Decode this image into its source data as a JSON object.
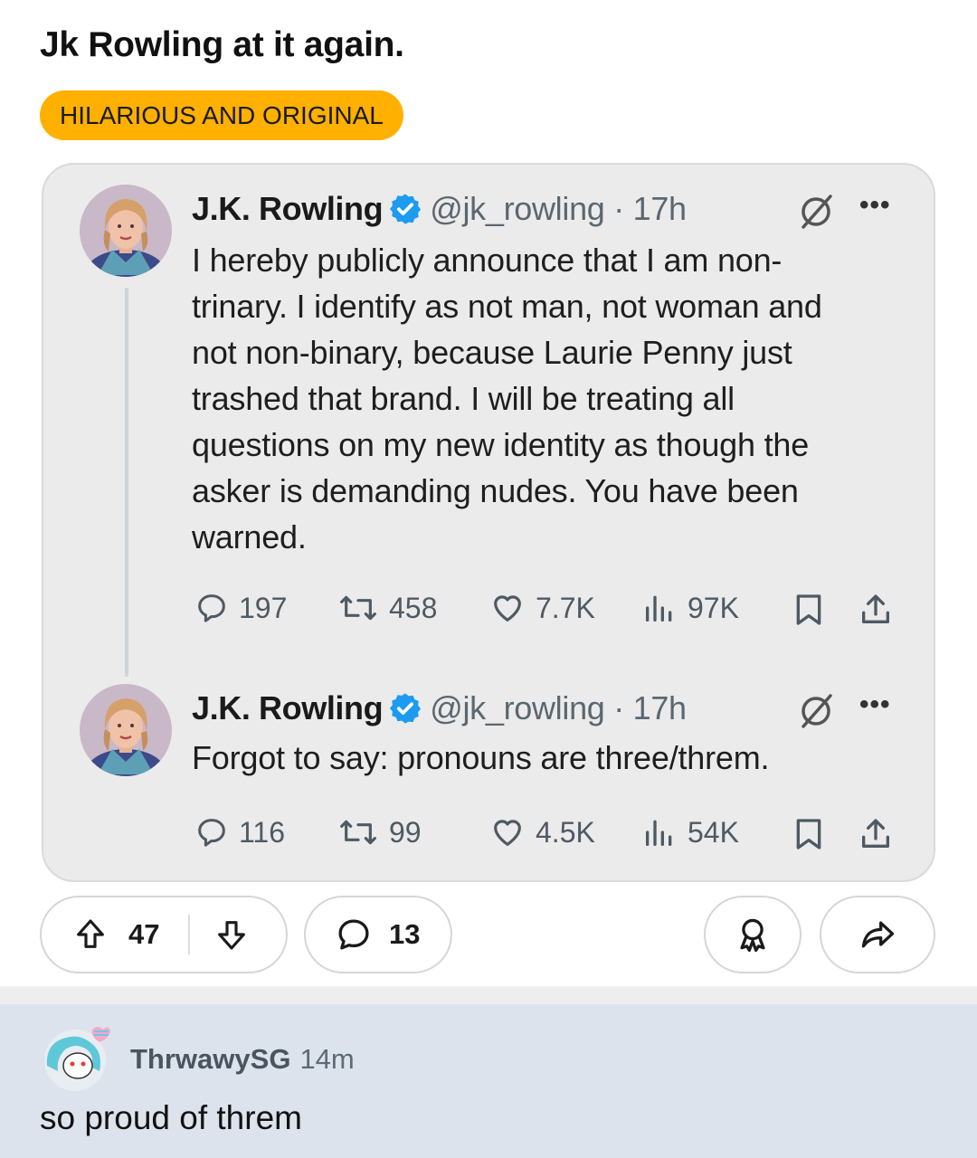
{
  "post": {
    "title": "Jk Rowling at it again.",
    "flair": "HILARIOUS AND ORIGINAL",
    "flair_color": "#ffb000"
  },
  "tweets": [
    {
      "name": "J.K. Rowling",
      "handle": "@jk_rowling · 17h",
      "text": "I hereby publicly announce that I am non-\ntrinary. I identify as not man, not woman and\nnot non-binary, because Laurie Penny just\ntrashed that brand. I will be treating all\nquestions on my new identity as though the\nasker is demanding nudes. You have been\nwarned.",
      "replies": "197",
      "retweets": "458",
      "likes": "7.7K",
      "views": "97K"
    },
    {
      "name": "J.K. Rowling",
      "handle": "@jk_rowling · 17h",
      "text": "Forgot to say: pronouns are three/threm.",
      "replies": "116",
      "retweets": "99",
      "likes": "4.5K",
      "views": "54K"
    }
  ],
  "actions": {
    "votes": "47",
    "comments": "13"
  },
  "comment": {
    "username": "ThrwawySG",
    "time": "14m",
    "text": "so proud of threm"
  },
  "colors": {
    "verified": "#1d9bf0",
    "card_bg": "#ebebeb",
    "comment_bg": "#dde3ec"
  }
}
